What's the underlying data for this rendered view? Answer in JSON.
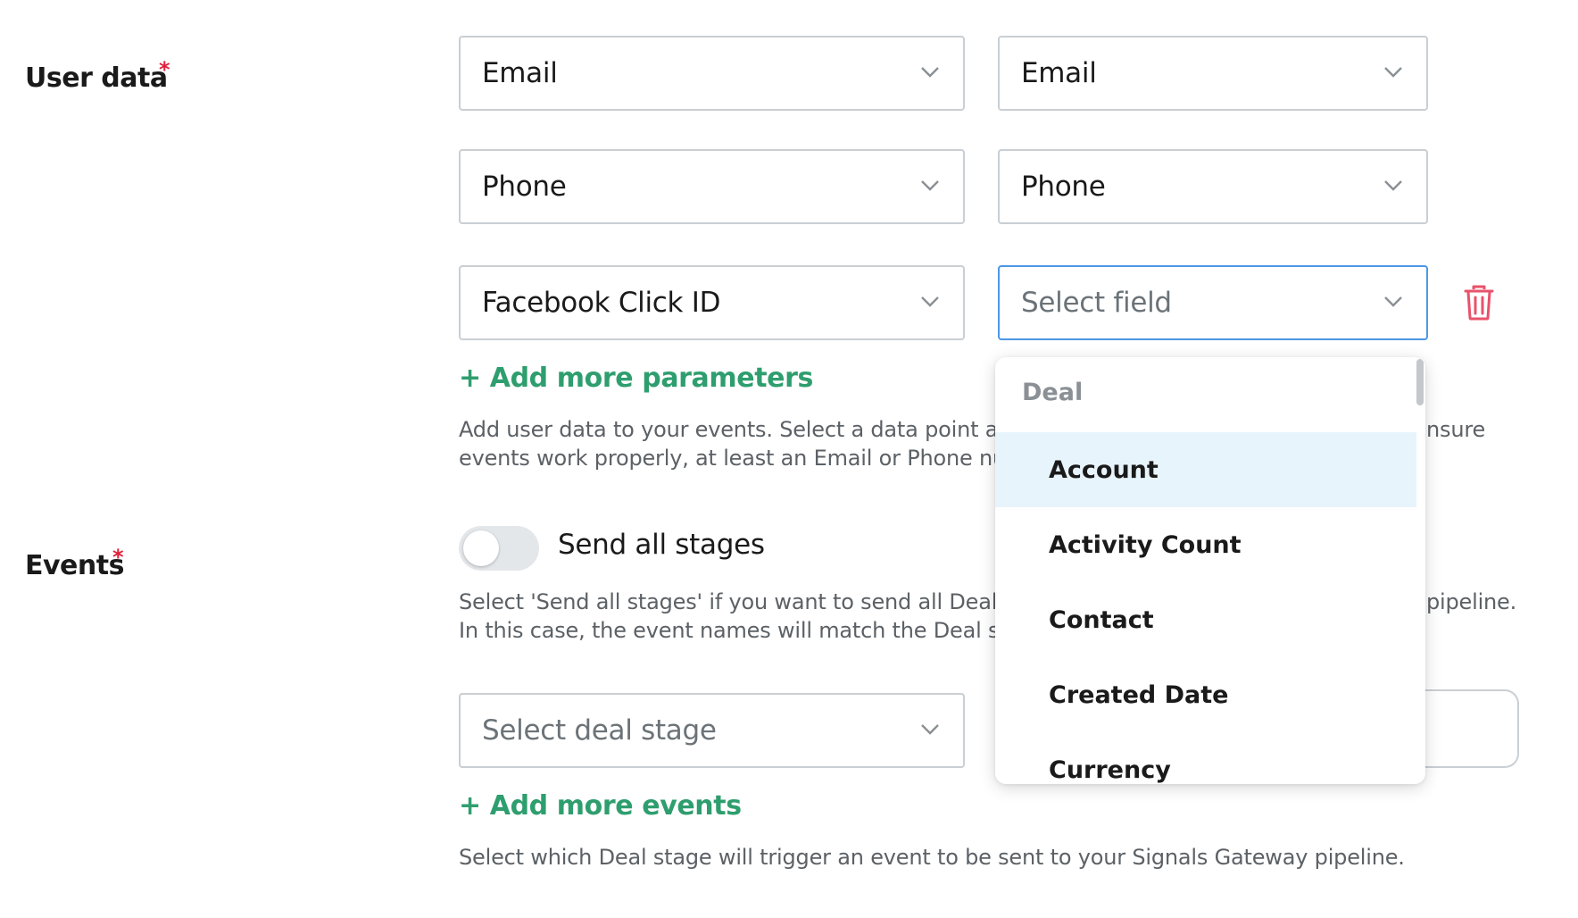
{
  "user_data": {
    "label": "User data",
    "required_mark": "*",
    "rows": [
      {
        "source": "Email",
        "target": "Email"
      },
      {
        "source": "Phone",
        "target": "Phone"
      },
      {
        "source": "Facebook Click ID",
        "target_placeholder": "Select field"
      }
    ],
    "add_link": "+ Add more parameters",
    "help_line1": "Add user data to your events. Select a data point and",
    "help_line1_end": "nsure",
    "help_line2": "events work properly, at least an Email or Phone num"
  },
  "events": {
    "label": "Events",
    "required_mark": "*",
    "toggle_label": "Send all stages",
    "toggle_on": false,
    "help_line1": "Select 'Send all stages' if you want to send all Deal s",
    "help_line1_end": "pipeline.",
    "help_line2": "In this case, the event names will match the Deal sta",
    "stage_placeholder": "Select deal stage",
    "add_link": "+ Add more events",
    "footer_help": "Select which Deal stage will trigger an event to be sent to your Signals Gateway pipeline."
  },
  "dropdown": {
    "group_label": "Deal",
    "items": [
      "Account",
      "Activity Count",
      "Contact",
      "Created Date",
      "Currency"
    ],
    "highlighted_item": "Account"
  },
  "colors": {
    "accent_green": "#2f9e6e",
    "required_red": "#e0203a",
    "focus_blue": "#4d97e6",
    "highlight_bg": "#e8f4fc",
    "trash_red": "#e8526a"
  },
  "icons": {
    "chevron": "chevron-down-icon",
    "delete": "trash-icon"
  }
}
